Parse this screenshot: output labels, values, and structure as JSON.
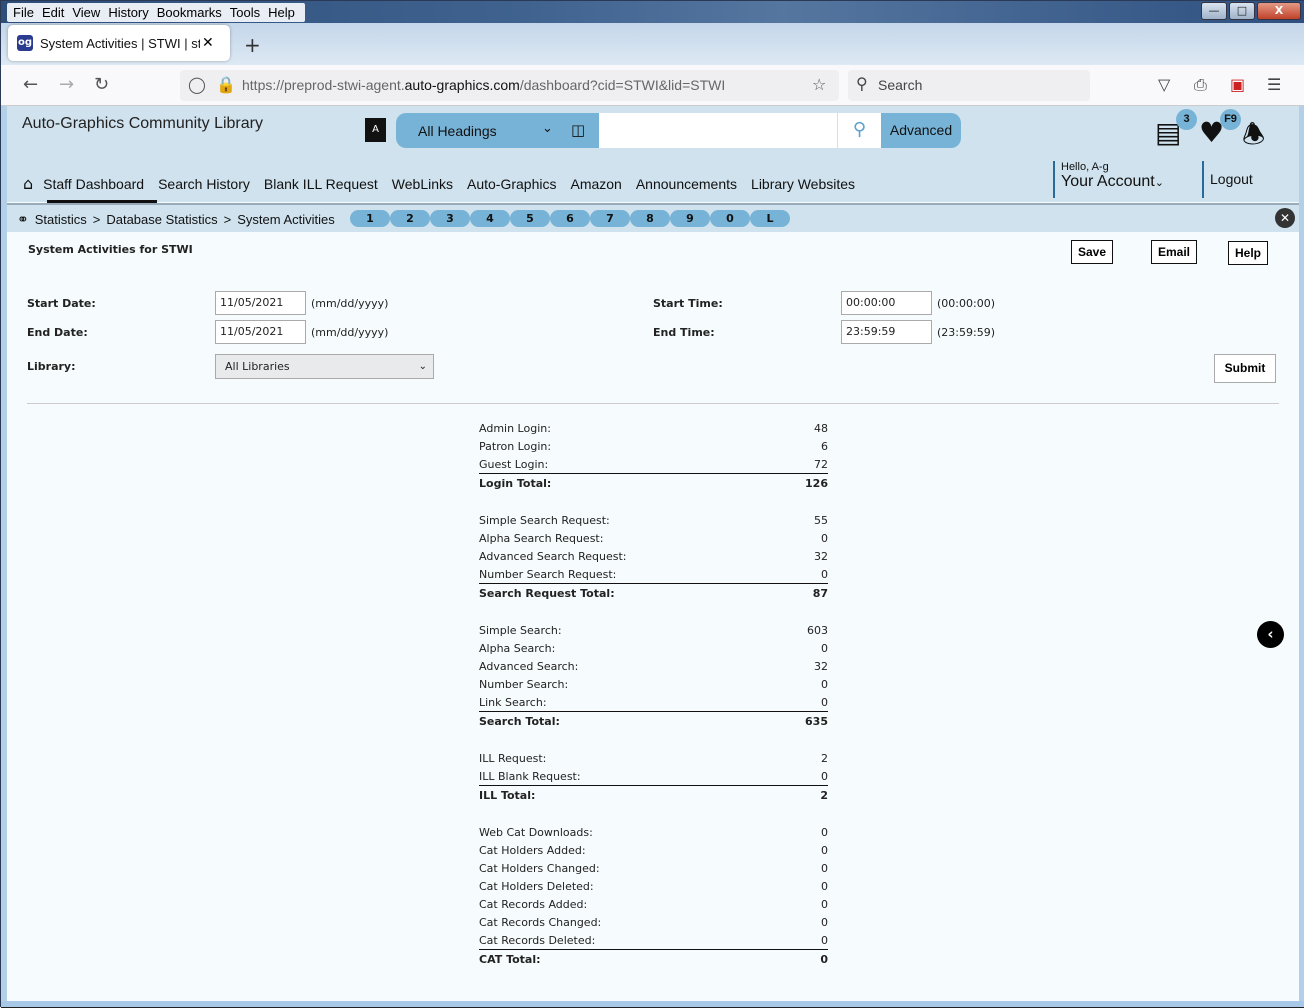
{
  "browser": {
    "menu": [
      "File",
      "Edit",
      "View",
      "History",
      "Bookmarks",
      "Tools",
      "Help"
    ],
    "tab_title": "System Activities | STWI | stwi | Auto-Graphics",
    "tab_favicon": "og",
    "url_prefix": "https://preprod-stwi-agent.",
    "url_domain": "auto-graphics.com",
    "url_suffix": "/dashboard?cid=STWI&lid=STWI",
    "search_placeholder": "Search"
  },
  "header": {
    "library_name": "Auto-Graphics Community Library",
    "heading_select": "All Headings",
    "search_value": "",
    "advanced_label": "Advanced",
    "list_badge": "3",
    "favorites_badge": "F9",
    "greeting": "Hello, A-g",
    "account_label": "Your Account",
    "logout_label": "Logout"
  },
  "nav": {
    "items": [
      "Staff Dashboard",
      "Search History",
      "Blank ILL Request",
      "WebLinks",
      "Auto-Graphics",
      "Amazon",
      "Announcements",
      "Library Websites"
    ],
    "active": "Staff Dashboard"
  },
  "breadcrumb": {
    "items": [
      "Statistics",
      "Database Statistics",
      "System Activities"
    ],
    "separator": ">",
    "quick_keys": [
      "1",
      "2",
      "3",
      "4",
      "5",
      "6",
      "7",
      "8",
      "9",
      "0",
      "L"
    ]
  },
  "page": {
    "title": "System Activities for STWI",
    "save_label": "Save",
    "email_label": "Email",
    "help_label": "Help",
    "start_date_label": "Start Date:",
    "start_date_value": "11/05/2021",
    "date_hint": "(mm/dd/yyyy)",
    "end_date_label": "End Date:",
    "end_date_value": "11/05/2021",
    "start_time_label": "Start Time:",
    "start_time_value": "00:00:00",
    "start_time_hint": "(00:00:00)",
    "end_time_label": "End Time:",
    "end_time_value": "23:59:59",
    "end_time_hint": "(23:59:59)",
    "library_label": "Library:",
    "library_value": "All Libraries",
    "submit_label": "Submit"
  },
  "stats": [
    {
      "rows": [
        [
          "Admin Login:",
          "48"
        ],
        [
          "Patron Login:",
          "6"
        ],
        [
          "Guest Login:",
          "72"
        ]
      ],
      "total": [
        "Login Total:",
        "126"
      ]
    },
    {
      "rows": [
        [
          "Simple Search Request:",
          "55"
        ],
        [
          "Alpha Search Request:",
          "0"
        ],
        [
          "Advanced Search Request:",
          "32"
        ],
        [
          "Number Search Request:",
          "0"
        ]
      ],
      "total": [
        "Search Request Total:",
        "87"
      ]
    },
    {
      "rows": [
        [
          "Simple Search:",
          "603"
        ],
        [
          "Alpha Search:",
          "0"
        ],
        [
          "Advanced Search:",
          "32"
        ],
        [
          "Number Search:",
          "0"
        ],
        [
          "Link Search:",
          "0"
        ]
      ],
      "total": [
        "Search Total:",
        "635"
      ]
    },
    {
      "rows": [
        [
          "ILL Request:",
          "2"
        ],
        [
          "ILL Blank Request:",
          "0"
        ]
      ],
      "total": [
        "ILL Total:",
        "2"
      ]
    },
    {
      "rows": [
        [
          "Web Cat Downloads:",
          "0"
        ],
        [
          "Cat Holders Added:",
          "0"
        ],
        [
          "Cat Holders Changed:",
          "0"
        ],
        [
          "Cat Holders Deleted:",
          "0"
        ],
        [
          "Cat Records Added:",
          "0"
        ],
        [
          "Cat Records Changed:",
          "0"
        ],
        [
          "Cat Records Deleted:",
          "0"
        ]
      ],
      "total": [
        "CAT Total:",
        "0"
      ]
    }
  ]
}
